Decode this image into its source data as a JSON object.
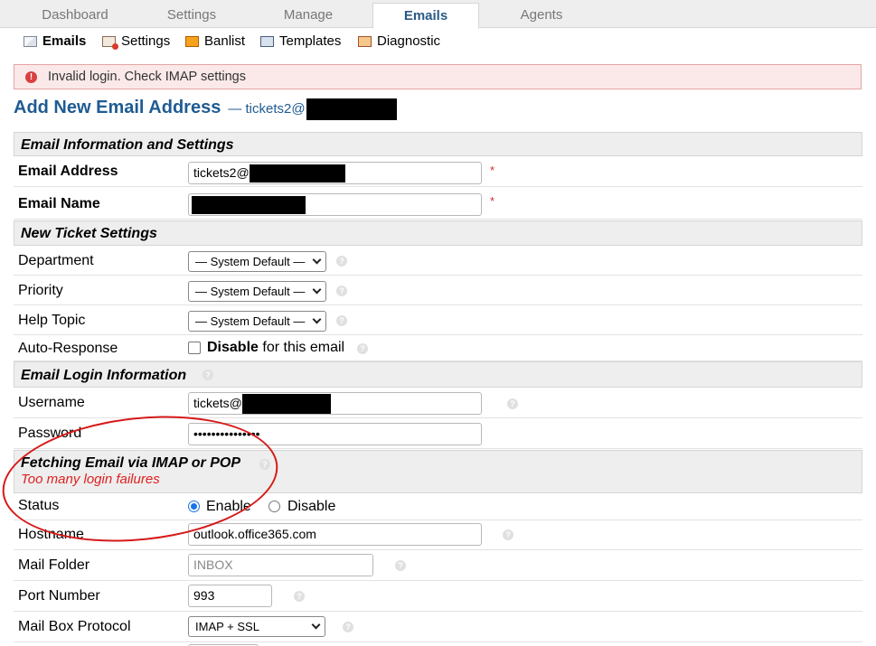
{
  "tabs": [
    "Dashboard",
    "Settings",
    "Manage",
    "Emails",
    "Agents"
  ],
  "subnav": {
    "emails": "Emails",
    "settings": "Settings",
    "banlist": "Banlist",
    "templates": "Templates",
    "diagnostic": "Diagnostic"
  },
  "error": {
    "icon": "!",
    "message": "Invalid login. Check IMAP settings"
  },
  "heading": {
    "title": "Add New Email Address",
    "subtitle": "— tickets2@"
  },
  "sections": {
    "info": "Email Information and Settings",
    "ticket": "New Ticket Settings",
    "login": "Email Login Information",
    "fetch": "Fetching Email via IMAP or POP",
    "fetch_error": "Too many login failures"
  },
  "fields": {
    "email_address_label": "Email Address",
    "email_address_value": "tickets2@",
    "email_name_label": "Email Name",
    "required_mark": "*",
    "department_label": "Department",
    "department_value": "— System Default —",
    "priority_label": "Priority",
    "priority_value": "— System Default —",
    "help_topic_label": "Help Topic",
    "help_topic_value": "— System Default —",
    "auto_response_label": "Auto-Response",
    "auto_response_disable": "Disable",
    "auto_response_suffix": "for this email",
    "username_label": "Username",
    "username_value": "tickets@",
    "password_label": "Password",
    "password_value": "•••••••••••••••",
    "status_label": "Status",
    "status_enable": "Enable",
    "status_disable": "Disable",
    "hostname_label": "Hostname",
    "hostname_value": "outlook.office365.com",
    "mail_folder_label": "Mail Folder",
    "mail_folder_placeholder": "INBOX",
    "port_label": "Port Number",
    "port_value": "993",
    "protocol_label": "Mail Box Protocol",
    "protocol_value": "IMAP + SSL"
  },
  "help_icon": "?",
  "colors": {
    "accent": "#1f5b93",
    "error_bg": "#fbe9e9",
    "required": "#d32f2f",
    "annotation": "#d61a1a"
  }
}
